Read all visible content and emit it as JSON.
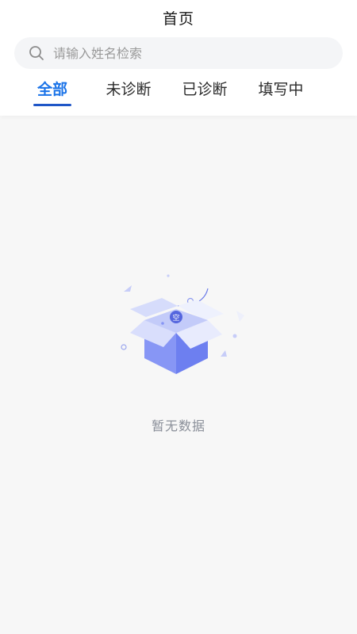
{
  "header": {
    "title": "首页"
  },
  "search": {
    "placeholder": "请输入姓名检索",
    "value": ""
  },
  "tabs": [
    {
      "label": "全部",
      "active": true
    },
    {
      "label": "未诊断",
      "active": false
    },
    {
      "label": "已诊断",
      "active": false
    },
    {
      "label": "填写中",
      "active": false
    }
  ],
  "empty_state": {
    "message": "暂无数据",
    "illustration_label": "空",
    "icon": "empty-box-icon"
  },
  "colors": {
    "accent": "#1a73e8",
    "tab_underline": "#1f56c7",
    "page_background": "#f7f7f7",
    "box": "#7b8ef5"
  }
}
